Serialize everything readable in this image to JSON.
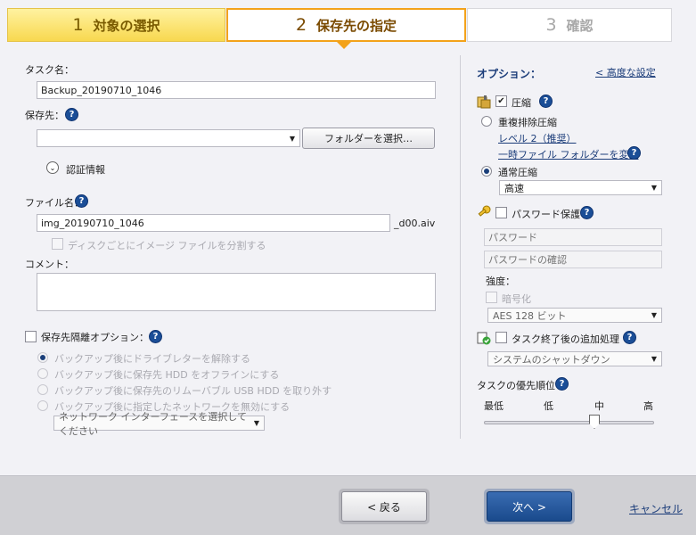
{
  "steps": [
    {
      "num": "1",
      "label": "対象の選択"
    },
    {
      "num": "2",
      "label": "保存先の指定"
    },
    {
      "num": "3",
      "label": "確認"
    }
  ],
  "left": {
    "task_name_label": "タスク名：",
    "task_name_value": "Backup_20190710_1046",
    "destination_label": "保存先：",
    "destination_value": "",
    "select_folder_button": "フォルダーを選択…",
    "auth_info_label": "認証情報",
    "file_name_label": "ファイル名：",
    "file_name_value": "img_20190710_1046",
    "file_suffix": "_d00.aiv",
    "split_per_disk_label": "ディスクごとにイメージ ファイルを分割する",
    "comment_label": "コメント：",
    "comment_value": "",
    "isolation_label": "保存先隔離オプション：",
    "isolation_options": [
      "バックアップ後にドライブレターを解除する",
      "バックアップ後に保存先 HDD をオフラインにする",
      "バックアップ後に保存先のリムーバブル USB HDD を取り外す",
      "バックアップ後に指定したネットワークを無効にする"
    ],
    "network_select": "ネットワーク インターフェースを選択してください"
  },
  "right": {
    "options_title": "オプション：",
    "advanced_link": "< 高度な設定",
    "compress_label": "圧縮",
    "dedup_label": "重複排除圧縮",
    "level_link": "レベル 2（推奨）",
    "temp_folder_link": "一時ファイル フォルダーを変更",
    "normal_label": "通常圧縮",
    "normal_select": "高速",
    "password_label": "パスワード保護",
    "password_placeholder": "パスワード",
    "password_confirm_placeholder": "パスワードの確認",
    "strength_label": "強度：",
    "encrypt_label": "暗号化",
    "encrypt_select": "AES 128 ビット",
    "post_process_label": "タスク終了後の追加処理",
    "post_process_select": "システムのシャットダウン",
    "priority_label": "タスクの優先順位",
    "priority_levels": [
      "最低",
      "低",
      "中",
      "高"
    ],
    "priority_value": "中"
  },
  "footer": {
    "back": "< 戻る",
    "next": "次へ >",
    "cancel": "キャンセル"
  },
  "colors": {
    "accent_orange": "#f3a21a",
    "step1_yellow": "#f8d84f",
    "primary_blue": "#1b4e97",
    "link": "#1c3d7a"
  }
}
